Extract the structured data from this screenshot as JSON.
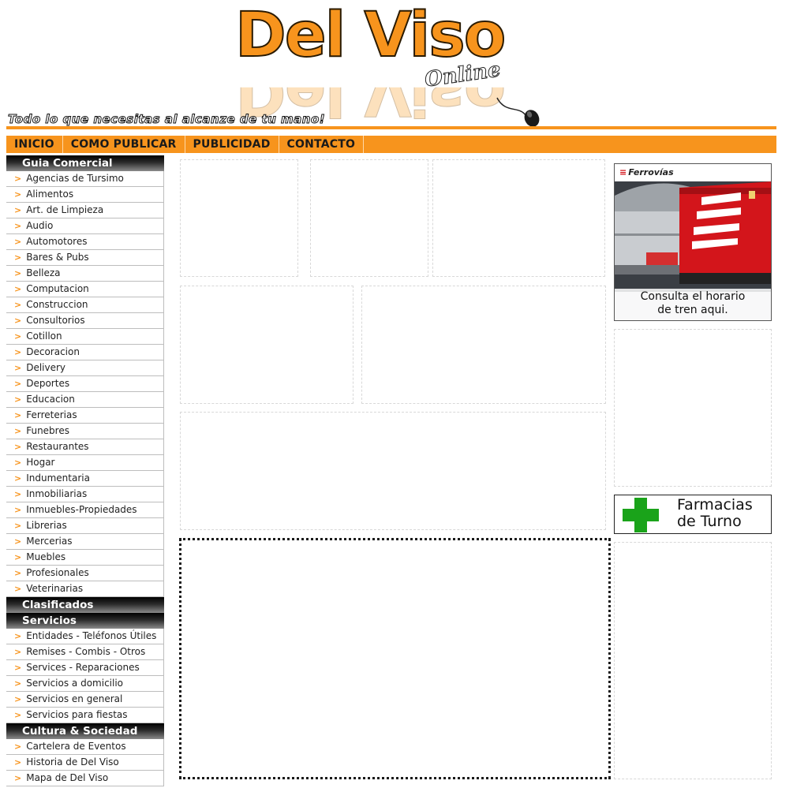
{
  "brand": {
    "title": "Del Viso",
    "subtitle": "Online",
    "tagline": "Todo lo que necesitas al alcanze de tu mano!",
    "accent_color": "#f7941d"
  },
  "nav": {
    "items": [
      {
        "label": "INICIO"
      },
      {
        "label": "COMO PUBLICAR"
      },
      {
        "label": "PUBLICIDAD"
      },
      {
        "label": "CONTACTO"
      }
    ]
  },
  "sidebar": {
    "guia": {
      "heading": "Guia Comercial",
      "items": [
        {
          "label": "Agencias de Tursimo"
        },
        {
          "label": "Alimentos"
        },
        {
          "label": "Art. de Limpieza"
        },
        {
          "label": "Audio"
        },
        {
          "label": "Automotores"
        },
        {
          "label": "Bares & Pubs"
        },
        {
          "label": "Belleza"
        },
        {
          "label": "Computacion"
        },
        {
          "label": "Construccion"
        },
        {
          "label": "Consultorios"
        },
        {
          "label": "Cotillon"
        },
        {
          "label": "Decoracion"
        },
        {
          "label": "Delivery"
        },
        {
          "label": "Deportes"
        },
        {
          "label": "Educacion"
        },
        {
          "label": "Ferreterias"
        },
        {
          "label": "Funebres"
        },
        {
          "label": "Restaurantes"
        },
        {
          "label": "Hogar"
        },
        {
          "label": "Indumentaria"
        },
        {
          "label": "Inmobiliarias"
        },
        {
          "label": "Inmuebles-Propiedades"
        },
        {
          "label": "Librerias"
        },
        {
          "label": "Mercerias"
        },
        {
          "label": "Muebles"
        },
        {
          "label": "Profesionales"
        },
        {
          "label": "Veterinarias"
        }
      ]
    },
    "clasificados": {
      "heading": "Clasificados"
    },
    "servicios": {
      "heading": "Servicios",
      "items": [
        {
          "label": "Entidades - Teléfonos Útiles"
        },
        {
          "label": "Remises - Combis - Otros"
        },
        {
          "label": "Services - Reparaciones"
        },
        {
          "label": "Servicios a domicilio"
        },
        {
          "label": "Servicios en general"
        },
        {
          "label": "Servicios para fiestas"
        }
      ]
    },
    "cultura": {
      "heading": "Cultura & Sociedad",
      "items": [
        {
          "label": "Cartelera de Eventos"
        },
        {
          "label": "Historia de Del Viso"
        },
        {
          "label": "Mapa de Del Viso"
        }
      ]
    },
    "arrow_glyph": ">"
  },
  "banners": {
    "ferrovias": {
      "brand": "Ferrovías",
      "caption_line1": "Consulta el horario",
      "caption_line2": "de tren aqui."
    },
    "farmacias": {
      "line1": "Farmacias",
      "line2": "de Turno",
      "cross_color": "#1aa31a"
    }
  }
}
